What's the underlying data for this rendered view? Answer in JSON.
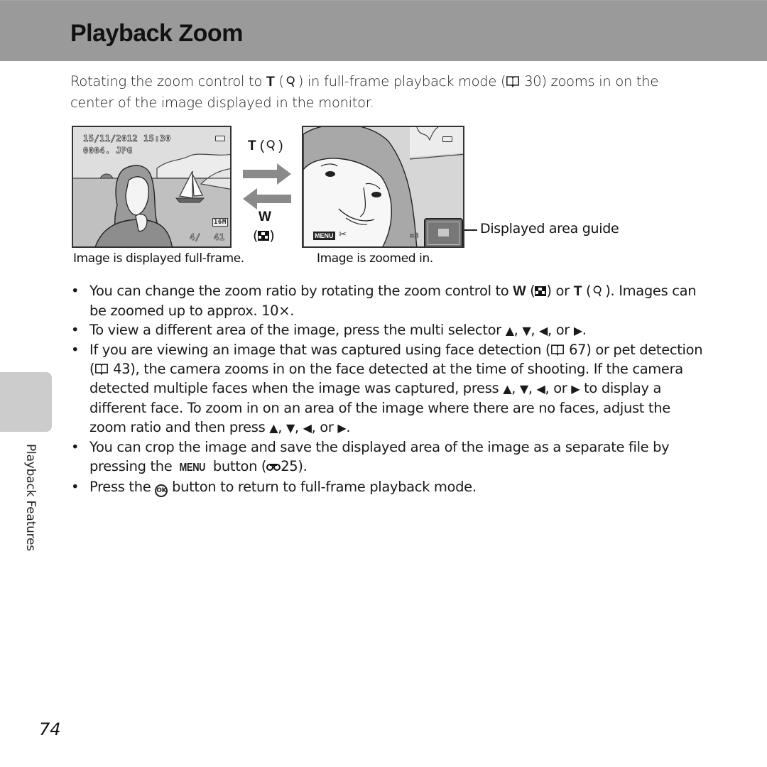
{
  "header": {
    "title": "Playback Zoom"
  },
  "intro": {
    "part1": "Rotating the zoom control to ",
    "t_key": "T",
    "part2": " (",
    "part3": ") in full-frame playback mode (",
    "ref_page": "30",
    "part4": ") zooms in on the center of the image displayed in the monitor."
  },
  "illustration": {
    "fullframe_screen": {
      "date_time": "15/11/2012  15:30",
      "filename": "0004. JPG",
      "image_size": "16M",
      "frame_counter": "4/",
      "total": "41"
    },
    "zoomed_screen": {
      "menu_label": "MENU",
      "zoom_ratio": "×3"
    },
    "t_label": "T",
    "w_label": "W",
    "caption_fullframe": "Image is displayed full-frame.",
    "caption_zoomed": "Image is zoomed in.",
    "guide_label": "Displayed area guide"
  },
  "bullets": [
    {
      "a": "You can change the zoom ratio by rotating the zoom control to ",
      "w": "W",
      "b": " (",
      "c": ") or ",
      "t": "T",
      "d": " (",
      "e": "). Images can be zoomed up to approx. 10×."
    },
    {
      "a": "To view a different area of the image, press the multi selector ",
      "up": "▲",
      "down": "▼",
      "left": "◀",
      "right": "▶",
      "sep": ", ",
      "or": ", or ",
      "end": "."
    },
    {
      "a": "If you are viewing an image that was captured using face detection (",
      "ref1": "67",
      "b": ") or pet detection (",
      "ref2": "43",
      "c": "), the camera zooms in on the face detected at the time of shooting. If the camera detected multiple faces when the image was captured, press ",
      "d": " to display a different face. To zoom in on an area of the image where there are no faces, adjust the zoom ratio and then press ",
      "e": "."
    },
    {
      "a": "You can crop the image and save the displayed area of the image as a separate file by pressing the ",
      "menu": "MENU",
      "b": " button (",
      "ref": "25",
      "c": ")."
    },
    {
      "a": "Press the ",
      "ok": "OK",
      "b": " button to return to full-frame playback mode."
    }
  ],
  "sidebar": {
    "section_label": "Playback Features"
  },
  "footer": {
    "page_number": "74"
  }
}
